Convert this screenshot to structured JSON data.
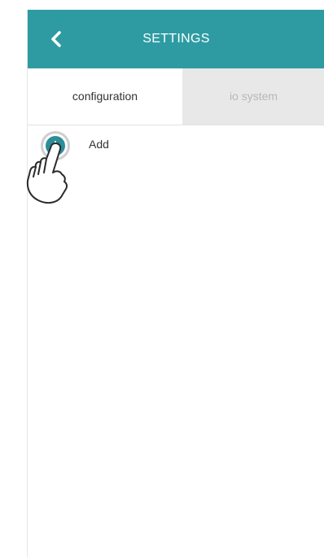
{
  "header": {
    "title": "SETTINGS",
    "back_icon": "chevron-left-icon"
  },
  "tabs": [
    {
      "label": "configuration",
      "active": true
    },
    {
      "label": "io system",
      "active": false
    }
  ],
  "add_action": {
    "label": "Add",
    "icon": "plus-circle-icon"
  },
  "colors": {
    "header_bg": "#2e9ba3",
    "add_button": "#2b8e98",
    "inactive_tab_bg": "#e8e8e8",
    "inactive_tab_text": "#b7b7b7"
  }
}
